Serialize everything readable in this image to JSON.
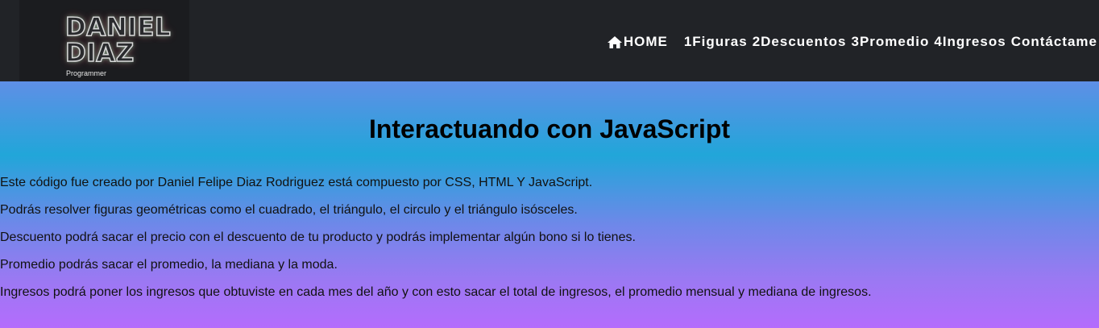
{
  "header": {
    "logo": {
      "line1": "DANIEL",
      "line2": "DIAZ",
      "subtitle": "Programmer"
    },
    "nav": {
      "home": "HOME",
      "figuras": "1Figuras",
      "descuentos": "2Descuentos",
      "promedio": "3Promedio",
      "ingresos": "4Ingresos",
      "contacto": "Contáctame"
    }
  },
  "main": {
    "title": "Interactuando con JavaScript",
    "paragraphs": [
      "Este código fue creado por Daniel Felipe Diaz Rodriguez está compuesto por CSS, HTML Y JavaScript.",
      "Podrás resolver figuras geométricas como el cuadrado, el triángulo, el circulo y el triángulo isósceles.",
      "Descuento podrá sacar el precio con el descuento de tu producto y podrás implementar algún bono si lo tienes.",
      "Promedio podrás sacar el promedio, la mediana y la moda.",
      "Ingresos podrá poner los ingresos que obtuviste en cada mes del año y con esto sacar el total de ingresos, el promedio mensual y mediana de ingresos."
    ]
  },
  "colors": {
    "navbar": "#212327",
    "gradient_top": "#5f8fe6",
    "gradient_mid": "#21a6d9",
    "gradient_bottom": "#b46cfd"
  },
  "icons": {
    "home": "home-icon"
  }
}
